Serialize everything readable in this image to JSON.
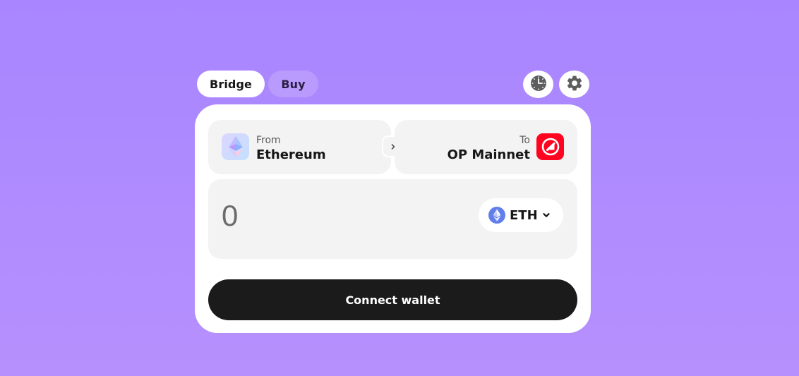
{
  "tabs": {
    "bridge_label": "Bridge",
    "buy_label": "Buy",
    "active": "Bridge"
  },
  "header_icons": {
    "history": "clock-icon",
    "settings": "gear-icon"
  },
  "from_chain": {
    "label": "From",
    "name": "Ethereum",
    "icon": "ethereum-icon"
  },
  "to_chain": {
    "label": "To",
    "name": "OP Mainnet",
    "icon": "optimism-icon",
    "brand_color": "#ff0420"
  },
  "amount": {
    "placeholder": "0",
    "value": ""
  },
  "token": {
    "symbol": "ETH",
    "icon": "ethereum-icon",
    "color": "#627eea"
  },
  "connect_button": {
    "label": "Connect wallet"
  },
  "colors": {
    "background": "#a985ff",
    "card": "#ffffff",
    "panel": "#f3f3f3",
    "primary_button": "#1b1b1c"
  }
}
